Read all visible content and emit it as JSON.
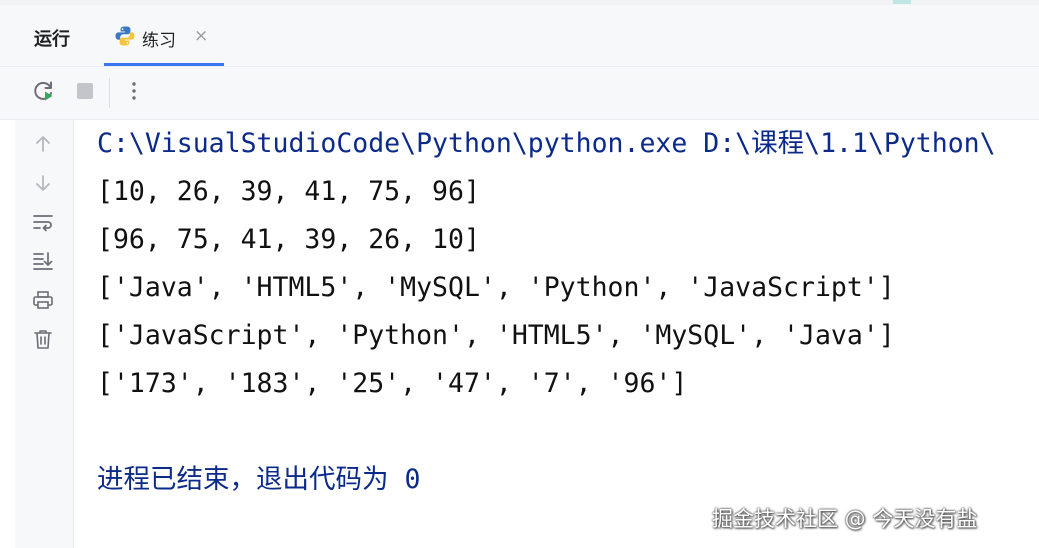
{
  "window": {
    "tool_title": "运行",
    "tab": {
      "label": "练习",
      "close": "×",
      "icon": "python-icon"
    }
  },
  "toolbar": {
    "buttons": [
      "rerun-icon",
      "stop-icon",
      "more-vertical-icon"
    ]
  },
  "gutter": {
    "buttons": [
      "arrow-up-icon",
      "arrow-down-icon",
      "soft-wrap-icon",
      "scroll-to-end-icon",
      "print-icon",
      "trash-icon"
    ]
  },
  "console": {
    "command": "C:\\VisualStudioCode\\Python\\python.exe D:\\课程\\1.1\\Python\\",
    "outputs": [
      "[10, 26, 39, 41, 75, 96]",
      "[96, 75, 41, 39, 26, 10]",
      "['Java', 'HTML5', 'MySQL', 'Python', 'JavaScript']",
      "['JavaScript', 'Python', 'HTML5', 'MySQL', 'Java']",
      "['173', '183', '25', '47', '7', '96']"
    ],
    "exit_message": "进程已结束，退出代码为 0"
  },
  "watermark": "掘金技术社区 @ 今天没有盐",
  "colors": {
    "command_text": "#0b2a8a",
    "output_text": "#111111",
    "tab_underline": "#3d74f2",
    "panel_bg": "#f7f8fa"
  }
}
